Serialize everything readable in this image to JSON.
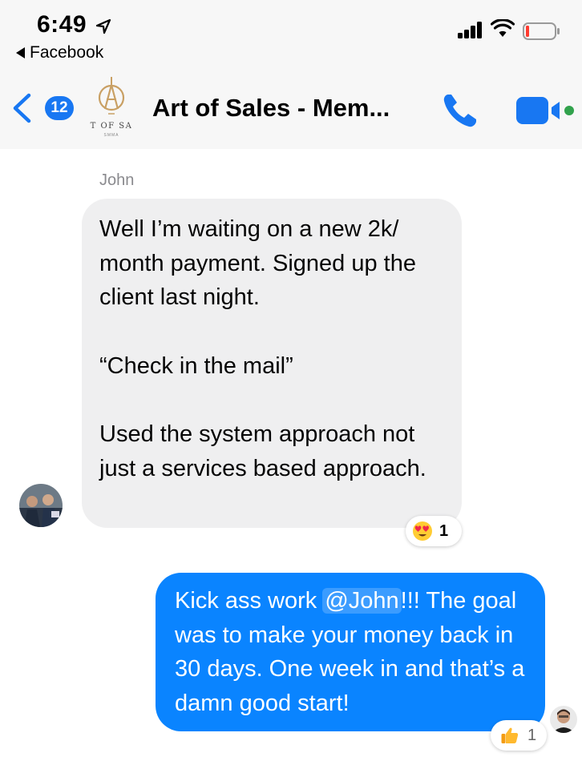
{
  "status_bar": {
    "time": "6:49",
    "back_app_label": "Facebook",
    "battery_color": "#ff3b30"
  },
  "header": {
    "unread_count": "12",
    "group_logo_caption": "T OF SA",
    "group_logo_subcaption": "SMMA",
    "title": "Art of Sales - Mem...",
    "accent_color": "#1877f2",
    "call_icon": "phone-icon",
    "video_icon": "video-camera-icon"
  },
  "messages": [
    {
      "sender": "John",
      "direction": "incoming",
      "paragraphs": [
        "Well I’m waiting on a new 2k/ month payment. Signed up the client last night.",
        "“Check in the mail”",
        "Used the system approach not just a services based approach."
      ],
      "reaction": {
        "icon": "heart-eyes-emoji-icon",
        "count": "1"
      }
    },
    {
      "direction": "outgoing",
      "text_before": "Kick ass work ",
      "mention": "@John",
      "text_after": "!!! The goal was to make your money back in 30 days. One week in and that’s a damn good start!",
      "reaction": {
        "icon": "thumbs-up-emoji-icon",
        "count": "1"
      }
    }
  ],
  "colors": {
    "outgoing_bubble": "#0a84ff",
    "incoming_bubble": "#efeff0"
  }
}
